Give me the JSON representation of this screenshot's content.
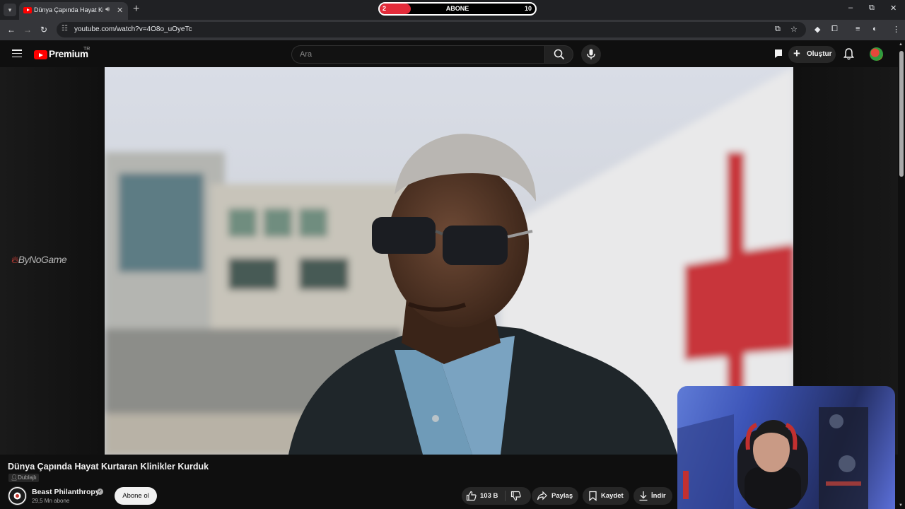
{
  "browser": {
    "tab_title": "Dünya Çapında Hayat Kurtaran Klinikler Kurduk - YouTube",
    "url": "youtube.com/watch?v=4O8o_uOyeTc",
    "new_tab": "+",
    "tab_close": "✕"
  },
  "overlay": {
    "subscriber_goal": {
      "current": "2",
      "label": "ABONE",
      "target": "10",
      "progress": 0.2,
      "accent": "#e32b3a"
    },
    "watermark": "ByNoGame"
  },
  "youtube": {
    "brand": "Premium",
    "region": "TR",
    "search_placeholder": "Ara",
    "create_label": "Oluştur",
    "brand_color": "#ff0000"
  },
  "video": {
    "title": "Dünya Çapında Hayat Kurtaran Klinikler Kurduk",
    "badge": "Dublajlı",
    "channel": "Beast Philanthropy",
    "subscribers": "29,5 Mn abone",
    "subscribe_label": "Abone ol",
    "likes": "103 B",
    "share_label": "Paylaş",
    "save_label": "Kaydet",
    "download_label": "İndir"
  },
  "icons": [
    "menu-icon",
    "search-icon",
    "mic-icon",
    "chat-icon",
    "bell-icon",
    "like-icon",
    "dislike-icon",
    "share-icon",
    "bookmark-icon",
    "download-icon"
  ]
}
